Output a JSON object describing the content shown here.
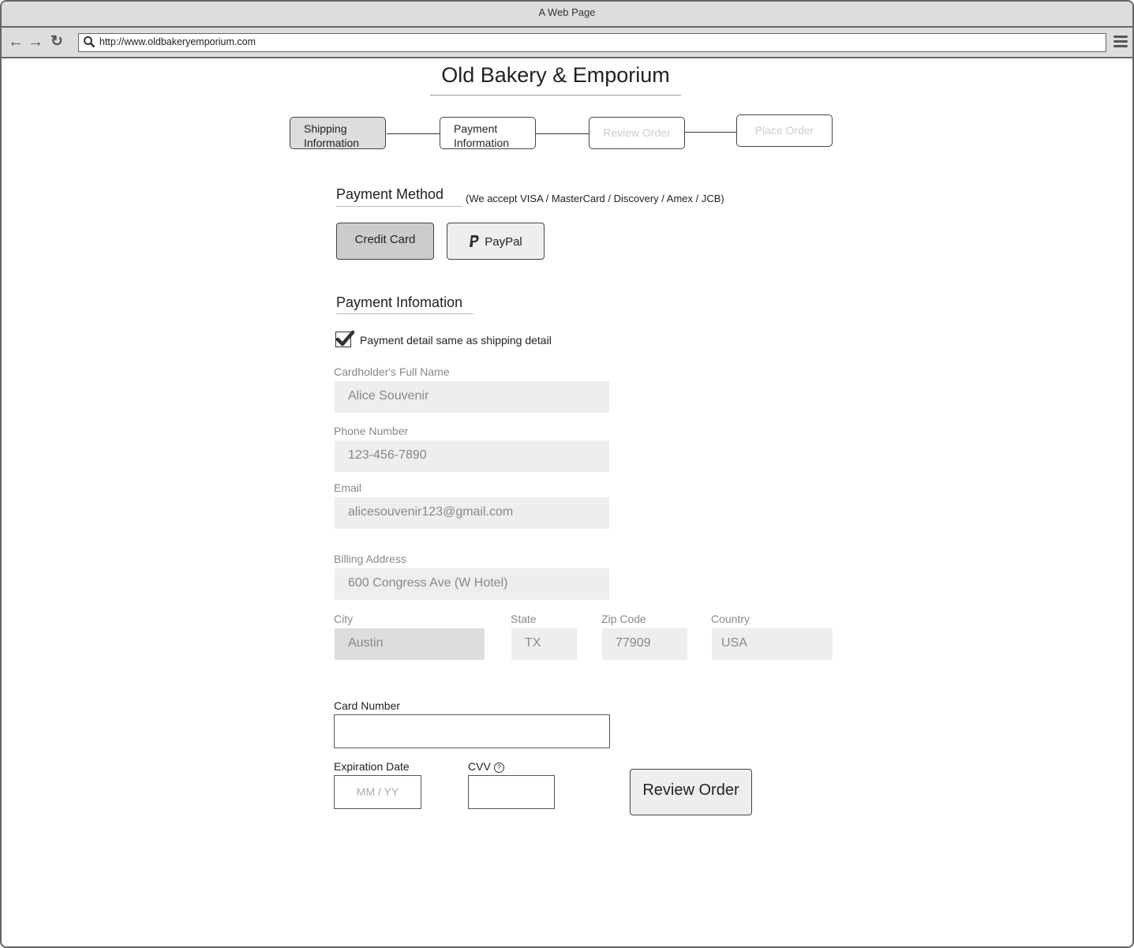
{
  "browser": {
    "window_title": "A Web Page",
    "url": "http://www.oldbakeryemporium.com",
    "icons": [
      "back-arrow-icon",
      "forward-arrow-icon",
      "reload-icon",
      "search-icon",
      "hamburger-menu-icon"
    ]
  },
  "site": {
    "title": "Old Bakery & Emporium"
  },
  "steps": [
    {
      "line1": "Shipping",
      "line2": "Information",
      "state": "completed"
    },
    {
      "line1": "Payment",
      "line2": "Information",
      "state": "current"
    },
    {
      "label": "Review Order",
      "state": "disabled"
    },
    {
      "label": "Place Order",
      "state": "disabled"
    }
  ],
  "payment_method": {
    "title": "Payment Method",
    "note": "(We accept VISA / MasterCard / Discovery / Amex / JCB)",
    "options": [
      {
        "label": "Credit Card",
        "selected": true
      },
      {
        "label": "PayPal",
        "icon": "paypal-icon",
        "selected": false
      }
    ]
  },
  "payment_info": {
    "title": "Payment Infomation",
    "same_as_shipping": {
      "label": "Payment detail same as shipping detail",
      "checked": true
    },
    "fields": {
      "full_name": {
        "label": "Cardholder's Full Name",
        "value": "Alice Souvenir"
      },
      "phone": {
        "label": "Phone Number",
        "value": "123-456-7890"
      },
      "email": {
        "label": "Email",
        "value": "alicesouvenir123@gmail.com"
      },
      "address": {
        "label": "Billing Address",
        "value": "600 Congress Ave (W Hotel)"
      },
      "city": {
        "label": "City",
        "value": "Austin"
      },
      "state": {
        "label": "State",
        "value": "TX"
      },
      "zip": {
        "label": "Zip Code",
        "value": "77909"
      },
      "country": {
        "label": "Country",
        "value": "USA"
      }
    },
    "card_number": {
      "label": "Card Number",
      "value": ""
    },
    "expiration": {
      "label": "Expiration Date",
      "placeholder": "MM / YY"
    },
    "cvv": {
      "label": "CVV",
      "help_icon": "?"
    },
    "submit_label": "Review Order"
  }
}
